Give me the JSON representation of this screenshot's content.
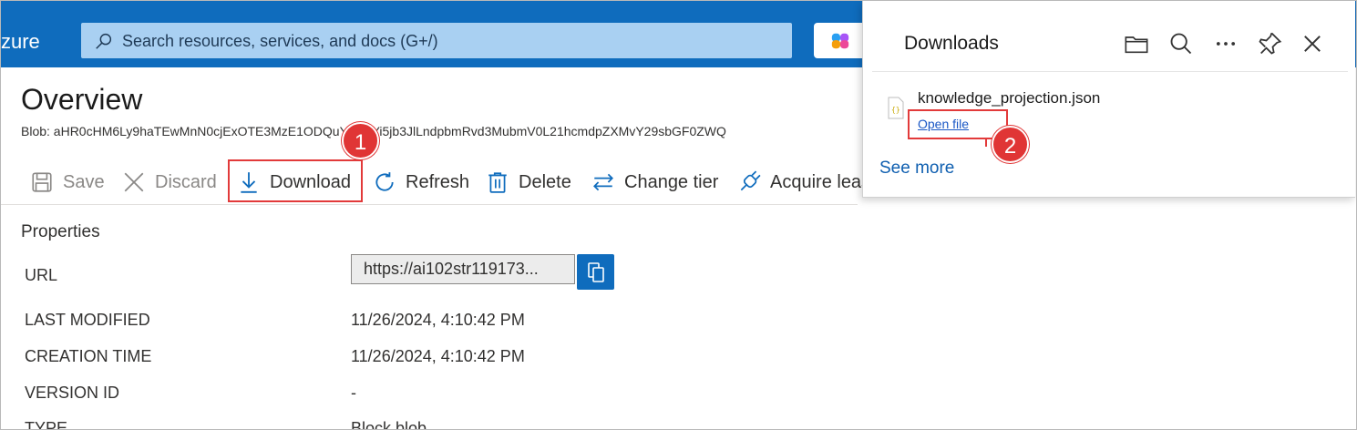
{
  "topbar": {
    "brand": "zure",
    "search_placeholder": "Search resources, services, and docs (G+/)"
  },
  "overview": {
    "title": "Overview",
    "blob": "Blob: aHR0cHM6Ly9haTEwMnN0cjExOTE3MzE1ODQuYmxvYi5jb3JlLndpbmRvd3MubmV0L21hcmdpZXMvY29sbGF0ZWQ"
  },
  "toolbar": {
    "save": "Save",
    "discard": "Discard",
    "download": "Download",
    "refresh": "Refresh",
    "delete": "Delete",
    "change_tier": "Change tier",
    "acquire_lease": "Acquire leas"
  },
  "properties": {
    "heading": "Properties",
    "rows": [
      {
        "label": "URL",
        "value": "https://ai102str119173..."
      },
      {
        "label": "LAST MODIFIED",
        "value": "11/26/2024, 4:10:42 PM"
      },
      {
        "label": "CREATION TIME",
        "value": "11/26/2024, 4:10:42 PM"
      },
      {
        "label": "VERSION ID",
        "value": "-"
      },
      {
        "label": "TYPE",
        "value": "Block blob"
      }
    ]
  },
  "downloads": {
    "title": "Downloads",
    "file_name": "knowledge_projection.json",
    "open_file": "Open file",
    "see_more": "See more"
  },
  "annotations": {
    "badge1": "1",
    "badge2": "2",
    "color": "#e23a3a"
  },
  "colors": {
    "topbar": "#0f6cbd",
    "search": "#a9d0f2",
    "accent": "#0f6cbd"
  }
}
